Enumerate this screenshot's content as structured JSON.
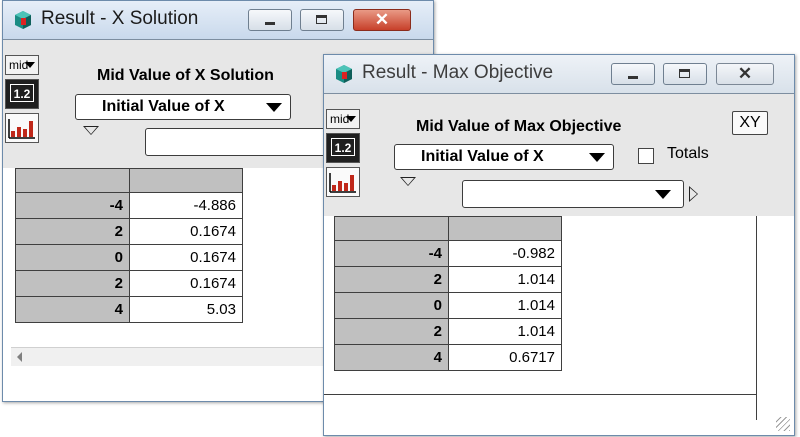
{
  "window_x": {
    "title": "Result - X Solution",
    "mid_label": "mid",
    "num_label": "1.2",
    "heading": "Mid Value of X Solution",
    "index_dropdown": "Initial Value of X",
    "rows": [
      {
        "index": "-4",
        "value": "-4.886"
      },
      {
        "index": "2",
        "value": "0.1674"
      },
      {
        "index": "0",
        "value": "0.1674"
      },
      {
        "index": "2",
        "value": "0.1674"
      },
      {
        "index": "4",
        "value": "5.03"
      }
    ]
  },
  "window_obj": {
    "title": "Result - Max Objective",
    "mid_label": "mid",
    "num_label": "1.2",
    "heading": "Mid Value of Max Objective",
    "xy_label": "XY",
    "index_dropdown": "Initial Value of X",
    "totals_label": "Totals",
    "rows": [
      {
        "index": "-4",
        "value": "-0.982"
      },
      {
        "index": "2",
        "value": "1.014"
      },
      {
        "index": "0",
        "value": "1.014"
      },
      {
        "index": "2",
        "value": "1.014"
      },
      {
        "index": "4",
        "value": "0.6717"
      }
    ]
  },
  "colors": {
    "close_active": "#c7402a",
    "index_cell": "#c0c0c0",
    "panel": "#e7e7e7"
  }
}
